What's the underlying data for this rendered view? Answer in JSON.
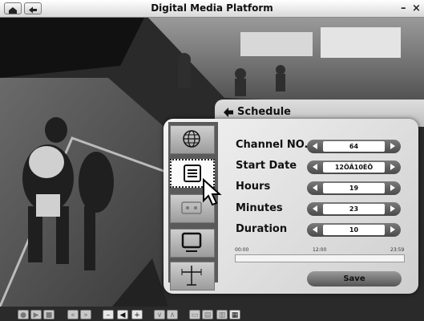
{
  "window": {
    "title": "Digital Media Platform",
    "minimize_glyph": "–",
    "close_glyph": "×",
    "home_icon": "home-icon",
    "back_icon": "back-arrow-icon"
  },
  "schedule": {
    "title": "Schedule",
    "rows": [
      {
        "label": "Channel NO.",
        "value": "64"
      },
      {
        "label": "Start Date",
        "value": "12ÔÂ10ÈÕ"
      },
      {
        "label": "Hours",
        "value": "19"
      },
      {
        "label": "Minutes",
        "value": "23"
      },
      {
        "label": "Duration",
        "value": "10"
      }
    ],
    "timeline": {
      "start": "00:00",
      "mid": "12:00",
      "end": "23:59"
    },
    "save_label": "Save",
    "side_icons": [
      "globe-icon",
      "list-icon",
      "recorder-icon",
      "monitor-icon",
      "antenna-icon"
    ]
  },
  "controls": [
    "●",
    "▶",
    "■",
    "«",
    "»",
    "–",
    "◀",
    "+",
    "∨",
    "∧",
    "▭",
    "▤",
    "▥",
    "▦"
  ]
}
